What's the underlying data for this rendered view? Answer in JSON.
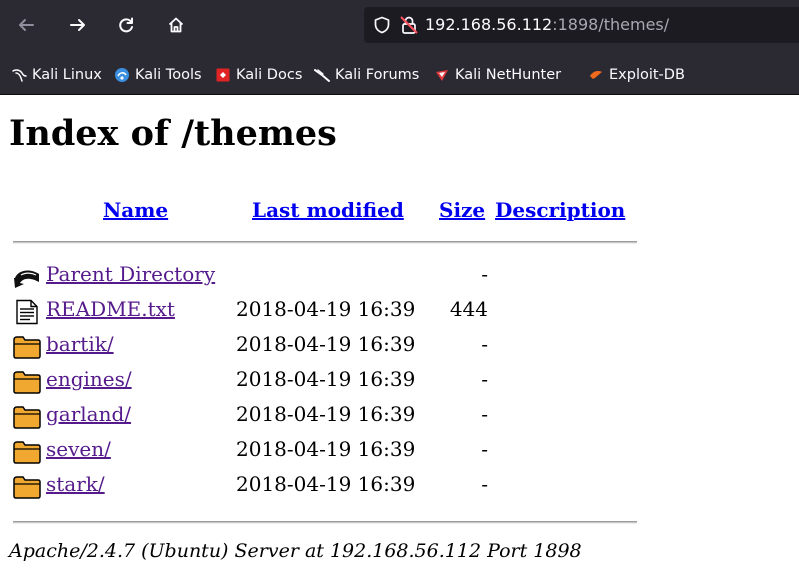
{
  "browser": {
    "url_host": "192.168.56.112",
    "url_rest": ":1898/themes/",
    "bookmarks": [
      {
        "label": "Kali Linux",
        "icon": "kali-dragon-icon"
      },
      {
        "label": "Kali Tools",
        "icon": "kali-tools-icon"
      },
      {
        "label": "Kali Docs",
        "icon": "kali-docs-icon"
      },
      {
        "label": "Kali Forums",
        "icon": "kali-forums-icon"
      },
      {
        "label": "Kali NetHunter",
        "icon": "kali-nethunter-icon"
      },
      {
        "label": "Exploit-DB",
        "icon": "exploit-db-icon"
      }
    ]
  },
  "page": {
    "title": "Index of /themes",
    "columns": {
      "name": "Name",
      "modified": "Last modified",
      "size": "Size",
      "description": "Description"
    },
    "rows": [
      {
        "icon": "back-arrow-icon",
        "name": "Parent Directory",
        "modified": "",
        "size": "-"
      },
      {
        "icon": "text-file-icon",
        "name": "README.txt",
        "modified": "2018-04-19 16:39",
        "size": "444"
      },
      {
        "icon": "folder-icon",
        "name": "bartik/",
        "modified": "2018-04-19 16:39",
        "size": "-"
      },
      {
        "icon": "folder-icon",
        "name": "engines/",
        "modified": "2018-04-19 16:39",
        "size": "-"
      },
      {
        "icon": "folder-icon",
        "name": "garland/",
        "modified": "2018-04-19 16:39",
        "size": "-"
      },
      {
        "icon": "folder-icon",
        "name": "seven/",
        "modified": "2018-04-19 16:39",
        "size": "-"
      },
      {
        "icon": "folder-icon",
        "name": "stark/",
        "modified": "2018-04-19 16:39",
        "size": "-"
      }
    ],
    "address": "Apache/2.4.7 (Ubuntu) Server at 192.168.56.112 Port 1898"
  },
  "colors": {
    "chrome": "#2b2a33",
    "urlbar": "#1c1b22",
    "link": "#0000ee",
    "visited": "#551a8b"
  }
}
